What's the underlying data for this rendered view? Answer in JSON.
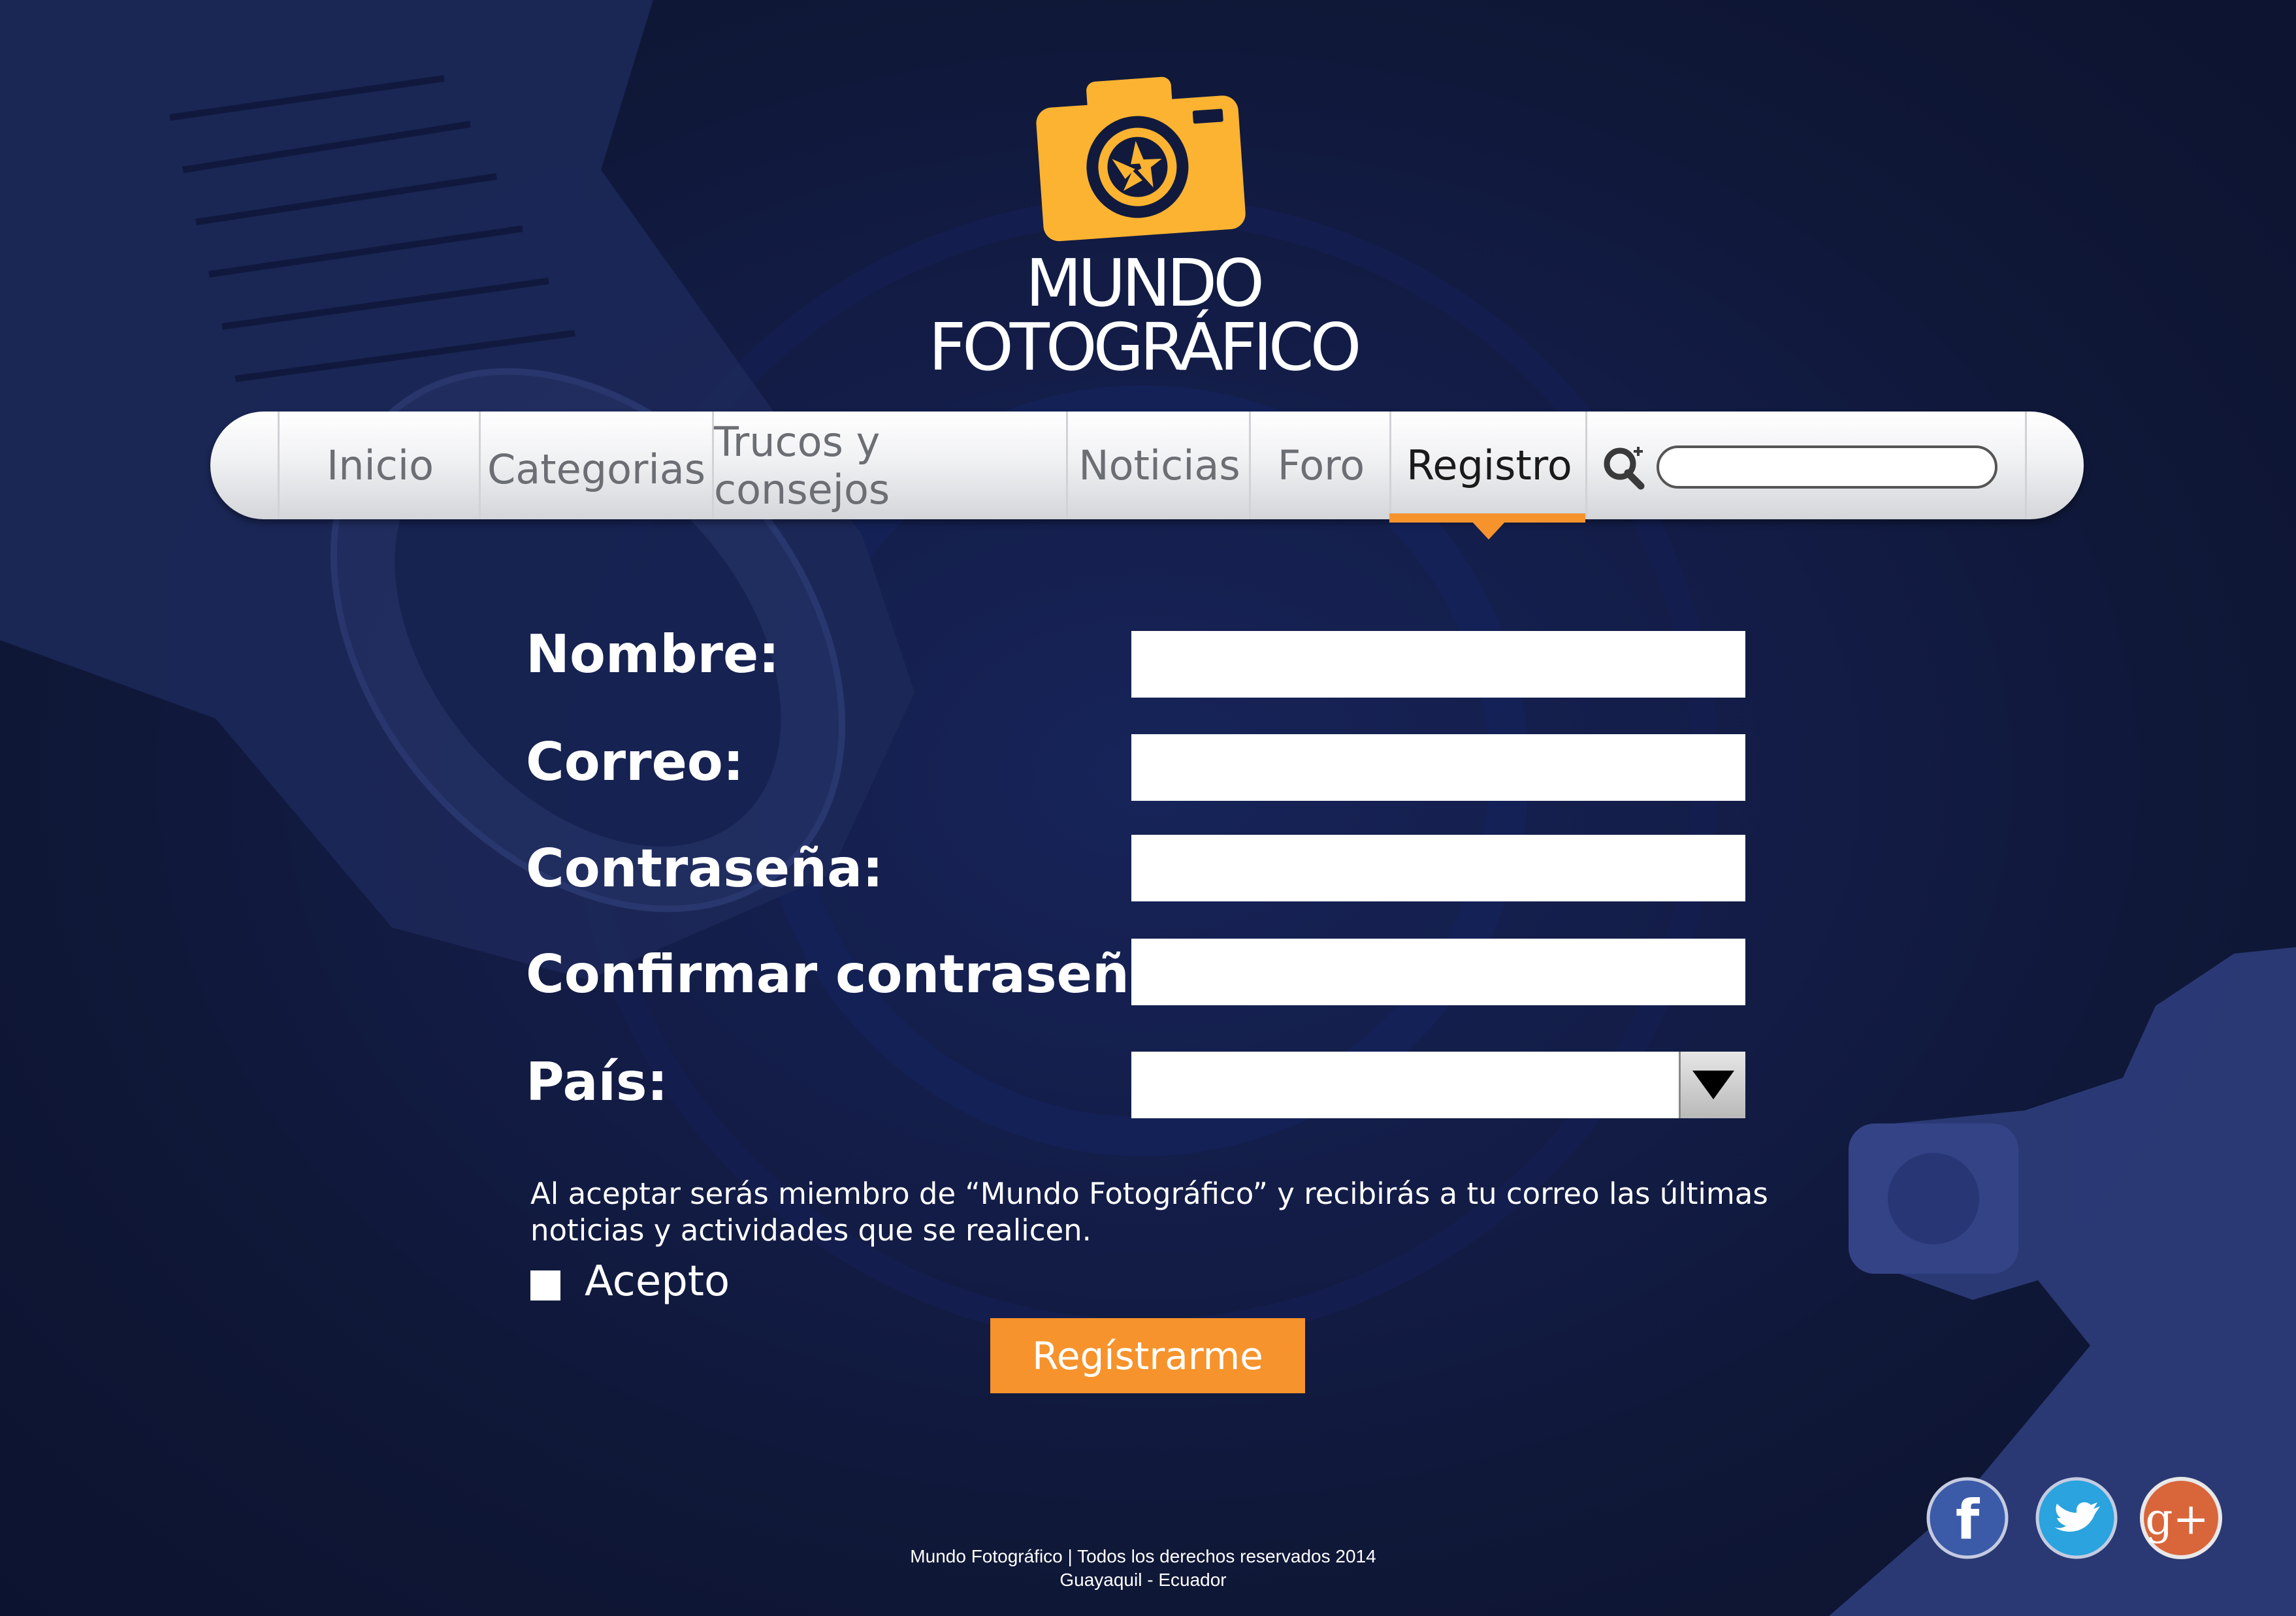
{
  "brand": {
    "line1": "MUNDO",
    "line2": "FOTOGRÁFICO",
    "logo_icon": "camera-aperture-icon",
    "logo_color": "#fbb331"
  },
  "nav": {
    "items": [
      {
        "label": "Inicio"
      },
      {
        "label": "Categorias"
      },
      {
        "label": "Trucos y consejos"
      },
      {
        "label": "Noticias"
      },
      {
        "label": "Foro"
      },
      {
        "label": "Registro",
        "active": true
      }
    ],
    "search_icon": "search-icon",
    "search_value": "",
    "accent_color": "#f6932c"
  },
  "form": {
    "nombre_label": "Nombre:",
    "nombre_value": "",
    "correo_label": "Correo:",
    "correo_value": "",
    "contrasena_label": "Contraseña:",
    "contrasena_value": "",
    "confirmar_label": "Confirmar contraseña:",
    "confirmar_value": "",
    "pais_label": "País:",
    "pais_value": "",
    "pais_dropdown_icon": "triangle-down-icon",
    "note": "Al aceptar serás miembro de “Mundo Fotográfico” y recibirás a tu correo las últimas noticias y actividades que se realicen.",
    "accept_label": "Acepto",
    "accept_checked": false,
    "submit_label": "Regístrarme"
  },
  "footer": {
    "line1": "Mundo Fotográfico | Todos los derechos reservados 2014",
    "line2": "Guayaquil - Ecuador"
  },
  "social": [
    {
      "icon": "facebook-icon",
      "glyph": "f",
      "color": "#3b5ba9"
    },
    {
      "icon": "twitter-icon",
      "glyph": "",
      "color": "#2aa3df"
    },
    {
      "icon": "google-plus-icon",
      "glyph": "g+",
      "color": "#d9653b"
    }
  ],
  "colors": {
    "background": "#111a3d",
    "text": "#ffffff"
  }
}
